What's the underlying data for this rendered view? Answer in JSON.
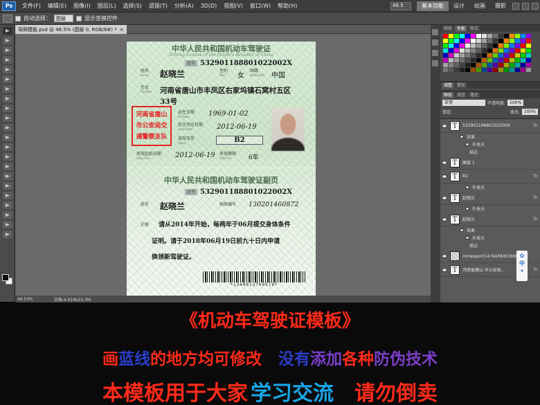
{
  "app": {
    "logo": "Ps",
    "menus": [
      "文件(F)",
      "编辑(E)",
      "图像(I)",
      "图层(L)",
      "选择(S)",
      "滤镜(T)",
      "分析(A)",
      "3D(D)",
      "视图(V)",
      "窗口(W)",
      "帮助(H)"
    ],
    "zoom": "46.5",
    "workspaces": [
      "基本功能",
      "设计",
      "绘画",
      "摄影"
    ],
    "active_workspace": "基本功能"
  },
  "options": {
    "auto_select_label": "自动选择：",
    "auto_select_value": "图层",
    "show_transform_label": "显示变换控件"
  },
  "document": {
    "tab_title": "驾照模板.psd @ 46.5% (图层 0, RGB/8#) *",
    "status_zoom": "46.53%",
    "status_doc": "文档:4.01M/23.7M"
  },
  "license": {
    "title": "中华人民共和国机动车驾驶证",
    "subtitle": "Driving License of the People's Republic of China",
    "id_tag": "证号",
    "id_number": "532901188801022002X",
    "name_label": "姓名",
    "name_label_en": "Name",
    "name": "赵晓兰",
    "sex_label": "性别",
    "sex_label_en": "M&F",
    "sex": "女",
    "nationality_label": "国籍",
    "nationality_label_en": "Nationality",
    "nationality": "中国",
    "address_label": "住址",
    "address_label_en": "Address",
    "address_line1": "河南省唐山市丰凤区右家坞镇石窝村五区",
    "address_line2": "33号",
    "stamp_line1": "河南省唐山",
    "stamp_line2": "市公安局交",
    "stamp_line3": "通警察支队",
    "birth_label": "出生日期",
    "birth_label_en": "Birthday",
    "birth": "1969-01-02",
    "issue_label": "初次领证日期",
    "issue_label_en": "Issue Date",
    "issue": "2012-06-19",
    "class_label": "准驾车型",
    "class_label_en": "Class",
    "class": "B2",
    "valid_from_label": "有效起始日期",
    "valid_from_label_en": "Valid From",
    "valid_from": "2012-06-19",
    "valid_for_label": "有效期限",
    "valid_for_label_en": "Valid For",
    "valid_for": "6年",
    "copy_title": "中华人民共和国机动车驾驶证副页",
    "copy_id_tag": "证号",
    "copy_id_number": "532901188801022002X",
    "copy_name_label": "姓名",
    "copy_name": "赵晓兰",
    "file_no_label": "档案编号",
    "file_no": "130201460872",
    "record_label": "记录",
    "record_line1": "请从2014年开始，每两年于06月提交身体条件",
    "record_line2": "证明。请于2018年06月19日前九十日内申请",
    "record_line3": "换领新驾驶证。",
    "barcode_text": "*1340013700579*"
  },
  "panels": {
    "color_tabs": [
      "颜色",
      "色板",
      "样式"
    ],
    "adjust_tabs": [
      "调整",
      "蒙版"
    ],
    "layer_tabs": [
      "图层",
      "通道",
      "路径"
    ],
    "blend_mode": "正常",
    "opacity_label": "不透明度:",
    "opacity": "100%",
    "lock_label": "锁定:",
    "fill_label": "填充:",
    "fill": "100%",
    "layers": [
      {
        "name": "53290118880102200X",
        "type": "text",
        "fx": true
      },
      {
        "name": "效果",
        "type": "sub"
      },
      {
        "name": "外发光",
        "type": "sub2"
      },
      {
        "name": "描边",
        "type": "sub3"
      },
      {
        "name": "图层 1",
        "type": "text",
        "fx": false
      },
      {
        "name": "B2",
        "type": "text",
        "fx": true
      },
      {
        "name": "外发光",
        "type": "sub2"
      },
      {
        "name": "赵晓兰",
        "type": "text",
        "fx": true
      },
      {
        "name": "外发光",
        "type": "sub2"
      },
      {
        "name": "赵晓兰",
        "type": "text",
        "fx": true
      },
      {
        "name": "效果",
        "type": "sub"
      },
      {
        "name": "外发光",
        "type": "sub2"
      },
      {
        "name": "描边",
        "type": "sub3"
      },
      {
        "name": "mmexport1476438453690 副本",
        "type": "image",
        "fx": false
      },
      {
        "name": "河南省唐山 市公安局...",
        "type": "text",
        "fx": true
      }
    ],
    "side_badge": "中"
  },
  "banner": {
    "title": "《机动车驾驶证模板》",
    "line1_parts": [
      {
        "text": "画",
        "color": "red"
      },
      {
        "text": "蓝线",
        "color": "blue"
      },
      {
        "text": "的地方均可修改",
        "color": "red"
      },
      {
        "text": "没有",
        "color": "blue"
      },
      {
        "text": "添加",
        "color": "purple"
      },
      {
        "text": "各种",
        "color": "red"
      },
      {
        "text": "防伪技术",
        "color": "purple"
      }
    ],
    "line2_parts": [
      {
        "text": "本模板用于大家",
        "color": "red"
      },
      {
        "text": "学习交流",
        "color": "cyan"
      },
      {
        "text": "请勿倒卖",
        "color": "red"
      }
    ]
  }
}
